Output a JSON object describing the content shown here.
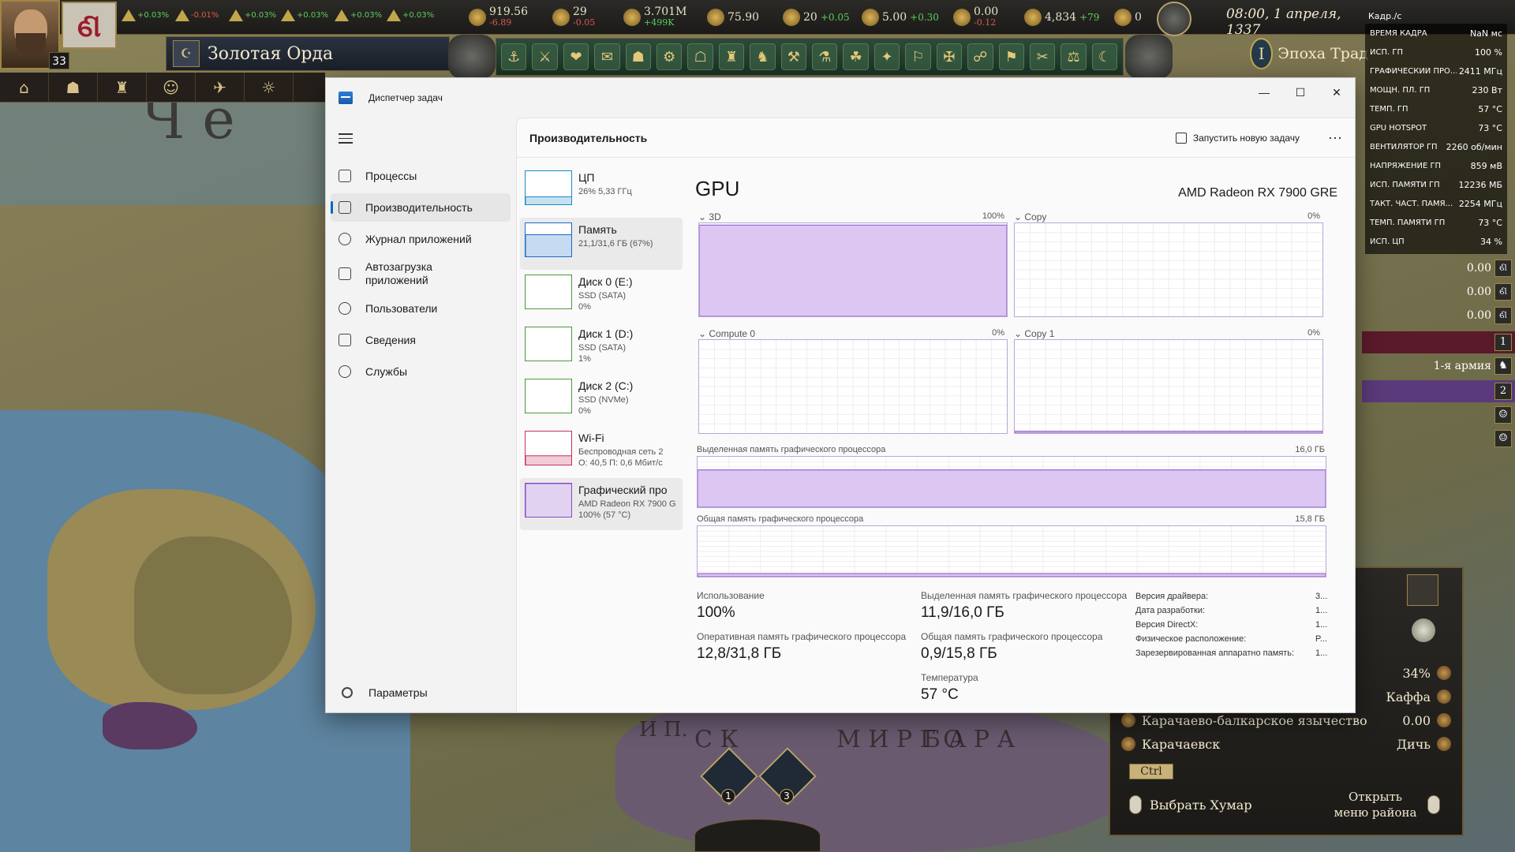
{
  "game": {
    "realm_name": "Золотая Орда",
    "ruler_age": "33",
    "coat_glyph": "ଣ",
    "date": "08:00, 1 апреля, 1337",
    "era": {
      "numeral": "I",
      "label": "Эпоха Трад"
    },
    "mini_resources": [
      {
        "delta": "+0.03%",
        "color": "#5ad05a"
      },
      {
        "delta": "-0.01%",
        "color": "#e05a4a"
      },
      {
        "delta": "+0.03%",
        "color": "#5ad05a"
      },
      {
        "delta": "+0.03%",
        "color": "#5ad05a"
      },
      {
        "delta": "+0.03%",
        "color": "#5ad05a"
      },
      {
        "delta": "+0.03%",
        "color": "#5ad05a"
      }
    ],
    "resources": [
      {
        "name": "gold",
        "value": "919.56",
        "delta": "-6.89",
        "sign": "neg"
      },
      {
        "name": "stability",
        "value": "29",
        "delta": "-0.05",
        "sign": "neg"
      },
      {
        "name": "manpower",
        "value": "3.701M",
        "delta": "+499K",
        "sign": "pos"
      },
      {
        "name": "legitimacy",
        "value": "75.90",
        "delta": "",
        "sign": ""
      },
      {
        "name": "prestige",
        "value": "20",
        "delta": "+0.05",
        "sign": "pos"
      },
      {
        "name": "diplomacy",
        "value": "5.00",
        "delta": "+0.30",
        "sign": "pos"
      },
      {
        "name": "war-exhaustion",
        "value": "0.00",
        "delta": "-0.12",
        "sign": "neg"
      },
      {
        "name": "army-size",
        "value": "4,834",
        "delta": "+79",
        "sign": "pos"
      },
      {
        "name": "navy-size",
        "value": "0",
        "delta": "",
        "sign": ""
      }
    ],
    "action_icons": [
      "⚓",
      "⚔",
      "❤",
      "✉",
      "☗",
      "⚙",
      "☖",
      "♜",
      "♞",
      "⚒",
      "⚗",
      "☘",
      "✦",
      "⚐",
      "✠",
      "☍",
      "⚑",
      "✂",
      "⚖",
      "☾",
      "✥"
    ],
    "left_menu": [
      "⌂",
      "☗",
      "♜",
      "☺",
      "✈",
      "☼"
    ],
    "right_rows": [
      {
        "value": "0.00",
        "badge": "ଣ"
      },
      {
        "value": "0.00",
        "badge": "ଣ"
      },
      {
        "value": "0.00",
        "badge": "ଣ"
      },
      {
        "value": "",
        "badge": "1"
      },
      {
        "value": "1-я армия",
        "badge": "♞"
      },
      {
        "value": "",
        "badge": "2"
      },
      {
        "value": "",
        "badge": "☺"
      },
      {
        "value": "",
        "badge": "☺"
      }
    ],
    "map_labels": [
      "Ч е",
      "С К",
      "М И Р Г О",
      "Б А Р А",
      "И П."
    ],
    "units": [
      "1",
      "3"
    ],
    "province": {
      "rows": [
        {
          "left": "",
          "right": "34%"
        },
        {
          "left": "",
          "right": "Каффа"
        },
        {
          "left": "Карачаево-балкарское язычество",
          "right": "0.00"
        },
        {
          "left": "Карачаевск",
          "right": "Дичь"
        }
      ],
      "ctrl": "Ctrl",
      "select": "Выбрать  Хумар",
      "open_menu": "Открыть меню района"
    }
  },
  "overlay": {
    "header": "Кадр./с",
    "rows": [
      {
        "key": "Время кадра",
        "value": "NaN мс"
      },
      {
        "key": "Исп. ГП",
        "value": "100 %"
      },
      {
        "key": "Графический про...",
        "value": "2411 МГц"
      },
      {
        "key": "Мощн. пл. ГП",
        "value": "230 Вт"
      },
      {
        "key": "Темп. ГП",
        "value": "57 °C"
      },
      {
        "key": "GPU Hotspot",
        "value": "73 °C"
      },
      {
        "key": "Вентилятор ГП",
        "value": "2260 об/мин"
      },
      {
        "key": "Напряжение ГП",
        "value": "859 мВ"
      },
      {
        "key": "Исп. памяти ГП",
        "value": "12236 МБ"
      },
      {
        "key": "Такт. част. памя...",
        "value": "2254 МГц"
      },
      {
        "key": "Темп. памяти ГП",
        "value": "73 °C"
      },
      {
        "key": "Исп. ЦП",
        "value": "34 %"
      }
    ]
  },
  "taskmanager": {
    "title": "Диспетчер задач",
    "window_controls": {
      "minimize": "—",
      "maximize": "☐",
      "close": "✕"
    },
    "nav": [
      {
        "label": "Процессы",
        "active": false
      },
      {
        "label": "Производительность",
        "active": true
      },
      {
        "label": "Журнал приложений",
        "active": false
      },
      {
        "label": "Автозагрузка приложений",
        "active": false
      },
      {
        "label": "Пользователи",
        "active": false
      },
      {
        "label": "Сведения",
        "active": false
      },
      {
        "label": "Службы",
        "active": false
      }
    ],
    "settings": "Параметры",
    "header": "Производительность",
    "run_task": "Запустить новую задачу",
    "more": "···",
    "resources": [
      {
        "name": "ЦП",
        "sub1": "26% 5,33 ГГц",
        "sub2": "",
        "sub3": "",
        "fill": 0.26,
        "color": "#1a8ac8"
      },
      {
        "name": "Память",
        "sub1": "21,1/31,6 ГБ (67%)",
        "sub2": "",
        "sub3": "",
        "fill": 0.67,
        "color": "#1a6ac8"
      },
      {
        "name": "Диск 0 (E:)",
        "sub1": "SSD (SATA)",
        "sub2": "0%",
        "sub3": "",
        "fill": 0,
        "color": "#4a9a3a"
      },
      {
        "name": "Диск 1 (D:)",
        "sub1": "SSD (SATA)",
        "sub2": "1%",
        "sub3": "",
        "fill": 0.01,
        "color": "#4a9a3a"
      },
      {
        "name": "Диск 2 (C:)",
        "sub1": "SSD (NVMe)",
        "sub2": "0%",
        "sub3": "",
        "fill": 0,
        "color": "#4a9a3a"
      },
      {
        "name": "Wi-Fi",
        "sub1": "Беспроводная сеть 2",
        "sub2": "О: 40,5 П: 0,6 Мбит/с",
        "sub3": "",
        "fill": 0.3,
        "color": "#c8325a"
      },
      {
        "name": "Графический про",
        "sub1": "AMD Radeon RX 7900 G",
        "sub2": "100% (57 °C)",
        "sub3": "",
        "fill": 1,
        "color": "#8a4ac8"
      }
    ],
    "gpu": {
      "title": "GPU",
      "model": "AMD Radeon RX 7900 GRE",
      "engines": [
        {
          "label": "3D",
          "pct": "100%",
          "level": 0.98
        },
        {
          "label": "Copy",
          "pct": "0%",
          "level": 0
        },
        {
          "label": "Compute 0",
          "pct": "0%",
          "level": 0
        },
        {
          "label": "Copy 1",
          "pct": "0%",
          "level": 0.02
        }
      ],
      "dedicated_label": "Выделенная память графического процессора",
      "dedicated_max": "16,0 ГБ",
      "dedicated_level": 0.74,
      "shared_label": "Общая память графического процессора",
      "shared_max": "15,8 ГБ",
      "shared_level": 0.06,
      "stats": {
        "usage_label": "Использование",
        "usage": "100%",
        "ded_label": "Выделенная память графического процессора",
        "ded": "11,9/16,0 ГБ",
        "ram_label": "Оперативная память графического процессора",
        "ram": "12,8/31,8 ГБ",
        "shared_label": "Общая память графического процессора",
        "shared": "0,9/15,8 ГБ",
        "temp_label": "Температура",
        "temp": "57 °C"
      },
      "info": [
        {
          "label": "Версия драйвера:",
          "value": "3..."
        },
        {
          "label": "Дата разработки:",
          "value": "1..."
        },
        {
          "label": "Версия DirectX:",
          "value": "1..."
        },
        {
          "label": "Физическое расположение:",
          "value": "P..."
        },
        {
          "label": "Зарезервированная аппаратно память:",
          "value": "1..."
        }
      ]
    }
  }
}
